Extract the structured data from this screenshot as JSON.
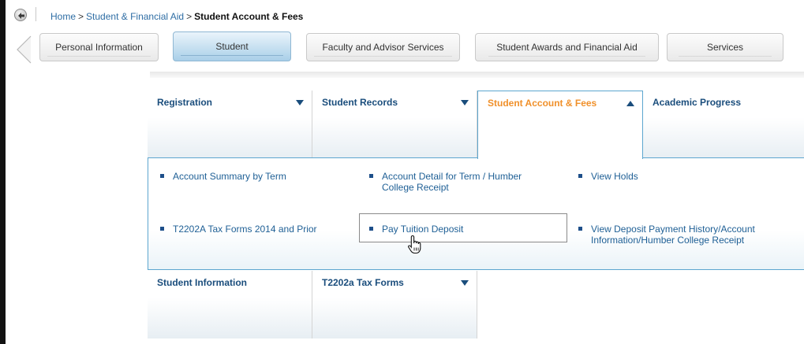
{
  "breadcrumb": {
    "items": [
      "Home",
      "Student & Financial Aid"
    ],
    "separator": ">",
    "current": "Student Account & Fees"
  },
  "tabs": [
    {
      "label": "Personal Information",
      "active": false
    },
    {
      "label": "Student",
      "active": true
    },
    {
      "label": "Faculty and Advisor Services",
      "active": false
    },
    {
      "label": "Student Awards and Financial Aid",
      "active": false
    },
    {
      "label": "Services",
      "active": false
    }
  ],
  "menu": {
    "headers": [
      {
        "label": "Registration",
        "open": false
      },
      {
        "label": "Student Records",
        "open": false
      },
      {
        "label": "Student Account & Fees",
        "open": true
      },
      {
        "label": "Academic Progress",
        "open": false
      }
    ],
    "dropdown_items": [
      {
        "label": "Account Summary by Term"
      },
      {
        "label": "Account Detail for Term / Humber College Receipt"
      },
      {
        "label": "View Holds"
      },
      {
        "label": "T2202A Tax Forms 2014 and Prior"
      },
      {
        "label": "Pay Tuition Deposit",
        "hovered": true
      },
      {
        "label": "View Deposit Payment History/Account Information/Humber College Receipt"
      }
    ],
    "bottom_headers": [
      {
        "label": "Student Information"
      },
      {
        "label": "T2202a Tax Forms"
      }
    ]
  },
  "colors": {
    "link": "#2e6da4",
    "menu_title": "#1a4d7c",
    "open_title": "#f0902a",
    "active_tab": "#a9cfe8",
    "panel_border": "#5ca6cf"
  }
}
